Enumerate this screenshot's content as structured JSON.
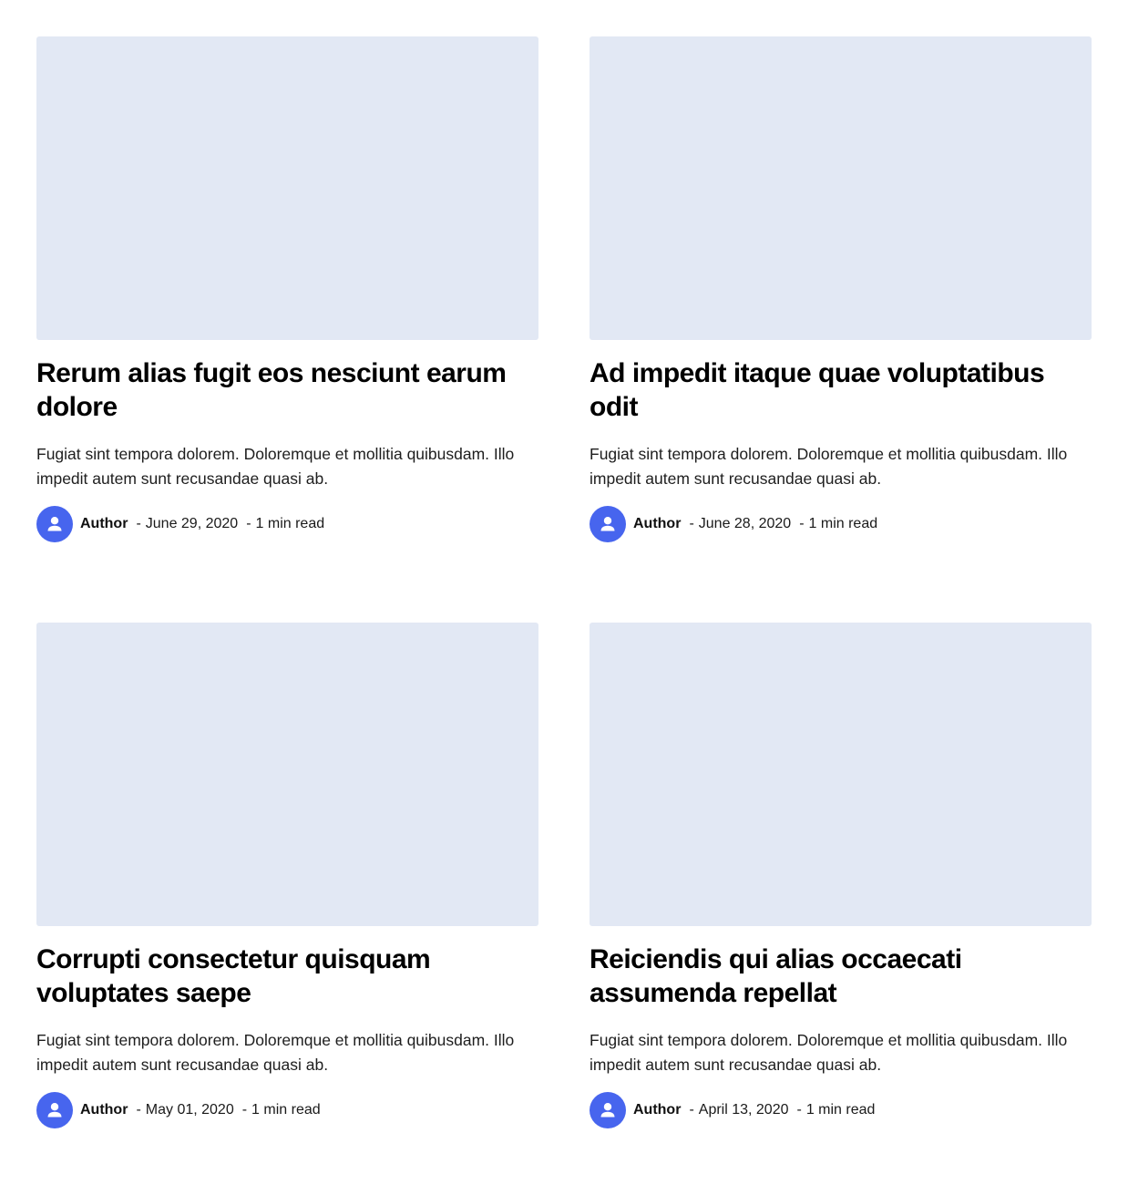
{
  "colors": {
    "placeholder_image": "#e2e8f4",
    "avatar_background": "#4765ee",
    "avatar_icon": "#ffffff"
  },
  "posts": [
    {
      "title": "Rerum alias fugit eos nesciunt earum dolore",
      "excerpt": "Fugiat sint tempora dolorem. Doloremque et mollitia quibusdam. Illo impedit autem sunt recusandae quasi ab.",
      "author": "Author",
      "separator_date": "-",
      "date": "June 29, 2020",
      "separator_read": "-",
      "read_time": "1 min read",
      "avatar_icon": "user-icon"
    },
    {
      "title": "Ad impedit itaque quae voluptatibus odit",
      "excerpt": "Fugiat sint tempora dolorem. Doloremque et mollitia quibusdam. Illo impedit autem sunt recusandae quasi ab.",
      "author": "Author",
      "separator_date": "-",
      "date": "June 28, 2020",
      "separator_read": "-",
      "read_time": "1 min read",
      "avatar_icon": "user-icon"
    },
    {
      "title": "Corrupti consectetur quisquam voluptates saepe",
      "excerpt": "Fugiat sint tempora dolorem. Doloremque et mollitia quibusdam. Illo impedit autem sunt recusandae quasi ab.",
      "author": "Author",
      "separator_date": "-",
      "date": "May 01, 2020",
      "separator_read": "-",
      "read_time": "1 min read",
      "avatar_icon": "user-icon"
    },
    {
      "title": "Reiciendis qui alias occaecati assumenda repellat",
      "excerpt": "Fugiat sint tempora dolorem. Doloremque et mollitia quibusdam. Illo impedit autem sunt recusandae quasi ab.",
      "author": "Author",
      "separator_date": "-",
      "date": "April 13, 2020",
      "separator_read": "-",
      "read_time": "1 min read",
      "avatar_icon": "user-icon"
    }
  ]
}
